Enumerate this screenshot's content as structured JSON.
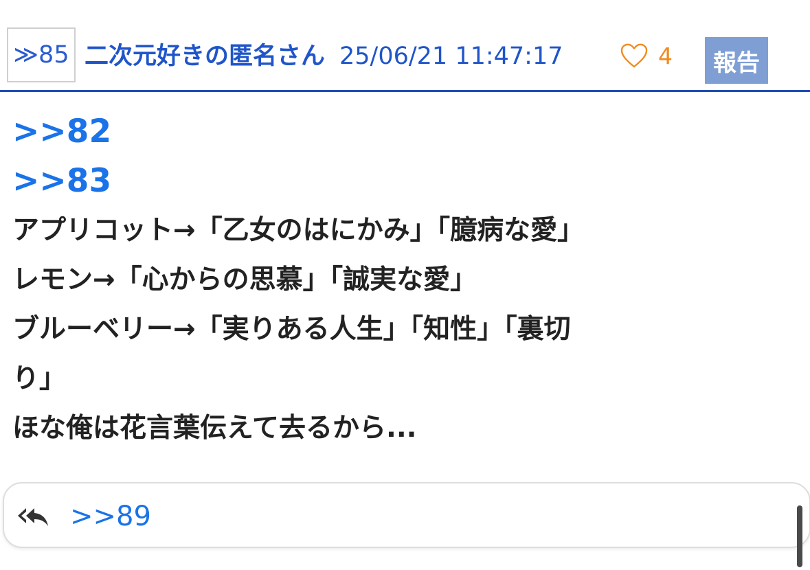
{
  "post": {
    "res_number": "≫85",
    "author": "二次元好きの匿名さん",
    "date": "25/06/21 11:47:17",
    "like_count": "4",
    "report_label": "報告",
    "anchors": [
      ">>82",
      ">>83"
    ],
    "body_lines": [
      "アプリコット→「乙女のはにかみ」「臆病な愛」",
      "レモン→「心からの思慕」「誠実な愛」",
      "ブルーベリー→「実りある人生」「知性」「裏切",
      "り」",
      "ほな俺は花言葉伝えて去るから..."
    ],
    "reply_link": ">>89"
  },
  "icons": {
    "like": "heart-outline-icon",
    "reply": "reply-all-icon"
  },
  "colors": {
    "header_text": "#1f55c9",
    "header_rule": "#1f4fb3",
    "link": "#1a73e8",
    "like": "#f08a1e",
    "report_bg": "#7f9fd4",
    "body_text": "#222222"
  }
}
